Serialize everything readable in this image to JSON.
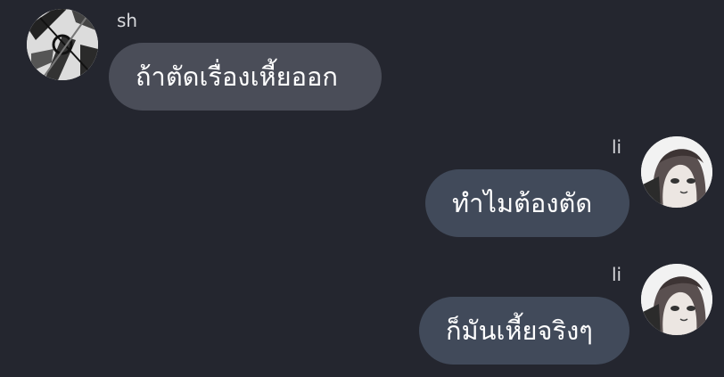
{
  "messages": [
    {
      "sender": "sh",
      "text": "ถ้าตัดเรื่องเหี้ยออก",
      "direction": "incoming"
    },
    {
      "sender": "li",
      "text": "ทำไมต้องตัด",
      "direction": "outgoing"
    },
    {
      "sender": "li",
      "text": "ก็มันเหี้ยจริงๆ",
      "direction": "outgoing"
    }
  ],
  "colors": {
    "background": "#24262f",
    "incoming_bubble": "#4a4d58",
    "outgoing_bubble": "#414a5a",
    "text": "#ffffff",
    "name": "#d7d8dc"
  }
}
